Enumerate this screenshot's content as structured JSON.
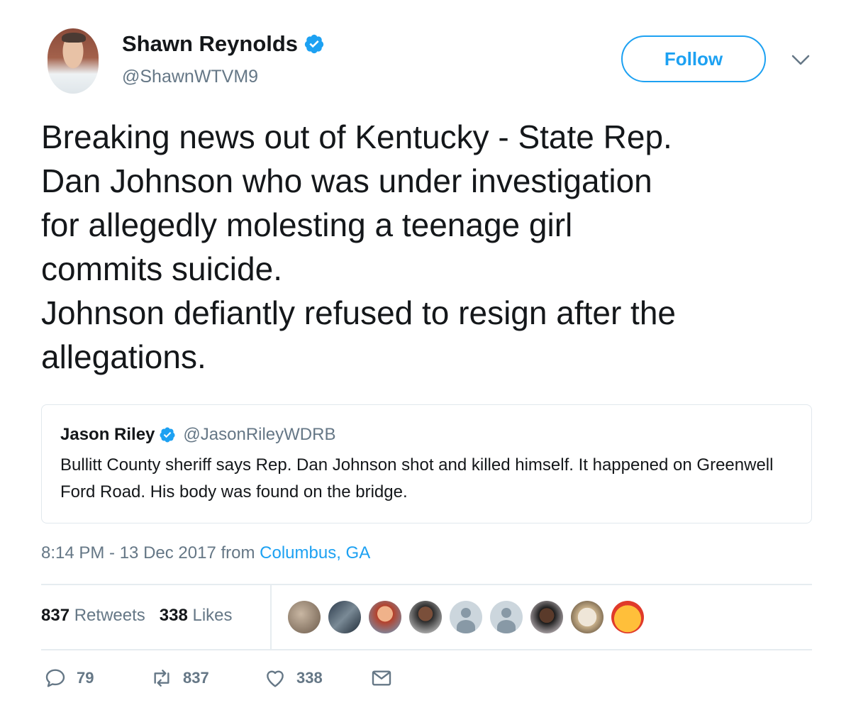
{
  "author": {
    "name": "Shawn Reynolds",
    "handle": "@ShawnWTVM9",
    "verified": true
  },
  "follow_label": "Follow",
  "tweet_text": "Breaking news out of Kentucky - State Rep.\nDan Johnson who was under investigation\nfor allegedly molesting a teenage girl\ncommits suicide.\nJohnson defiantly refused to resign after the\nallegations.",
  "quoted_tweet": {
    "name": "Jason Riley",
    "handle": "@JasonRileyWDRB",
    "verified": true,
    "text": "Bullitt County sheriff says Rep. Dan Johnson shot and killed himself. It happened on Greenwell Ford Road. His body was found on the bridge."
  },
  "timestamp": {
    "time": "8:14 PM - 13 Dec 2017 from ",
    "location": "Columbus, GA"
  },
  "stats": {
    "retweets_count": "837",
    "retweets_label": "Retweets",
    "likes_count": "338",
    "likes_label": "Likes"
  },
  "actions": {
    "replies": "79",
    "retweets": "837",
    "likes": "338"
  },
  "colors": {
    "accent": "#1da1f2",
    "text": "#14171a",
    "muted": "#657786",
    "border": "#e1e8ed"
  },
  "likers": [
    "liker-avatar",
    "liker-avatar",
    "liker-avatar",
    "liker-avatar",
    "default-avatar",
    "default-avatar",
    "liker-avatar",
    "liker-avatar",
    "liker-avatar"
  ]
}
